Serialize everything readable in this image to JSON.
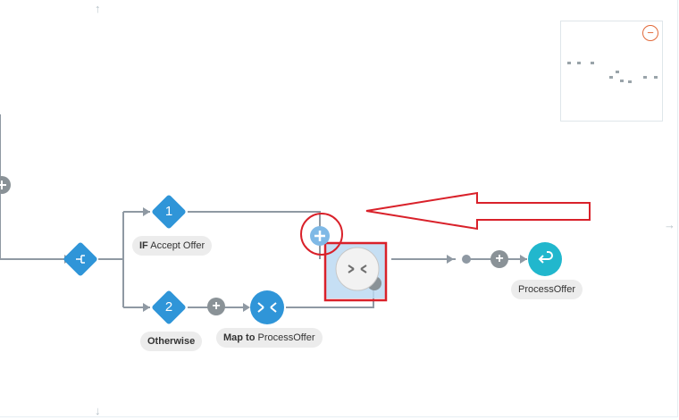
{
  "canvas": {
    "scroll_up": "↑",
    "scroll_down": "↓",
    "scroll_right": "→"
  },
  "nodes": {
    "if_branch": {
      "number": "1",
      "keyword": "IF",
      "label": "Accept Offer"
    },
    "otherwise_branch": {
      "number": "2",
      "label": "Otherwise"
    },
    "map_node": {
      "keyword": "Map to",
      "label": "ProcessOffer"
    },
    "process_offer": {
      "label": "ProcessOffer"
    }
  },
  "buttons": {
    "add_symbol": "+",
    "minimap_zoom_out": "−"
  },
  "colors": {
    "connector": "#8f99a3",
    "node_blue": "#2f95d8",
    "return_teal": "#21b7cd",
    "highlight_red": "#d9212a",
    "drop_target": "#bcd9f2"
  },
  "icons": {
    "switch_node": "switch-icon",
    "map_node": "merge-arrows-icon",
    "drop_target": "merge-arrows-icon",
    "process_offer": "return-arrow-icon"
  }
}
